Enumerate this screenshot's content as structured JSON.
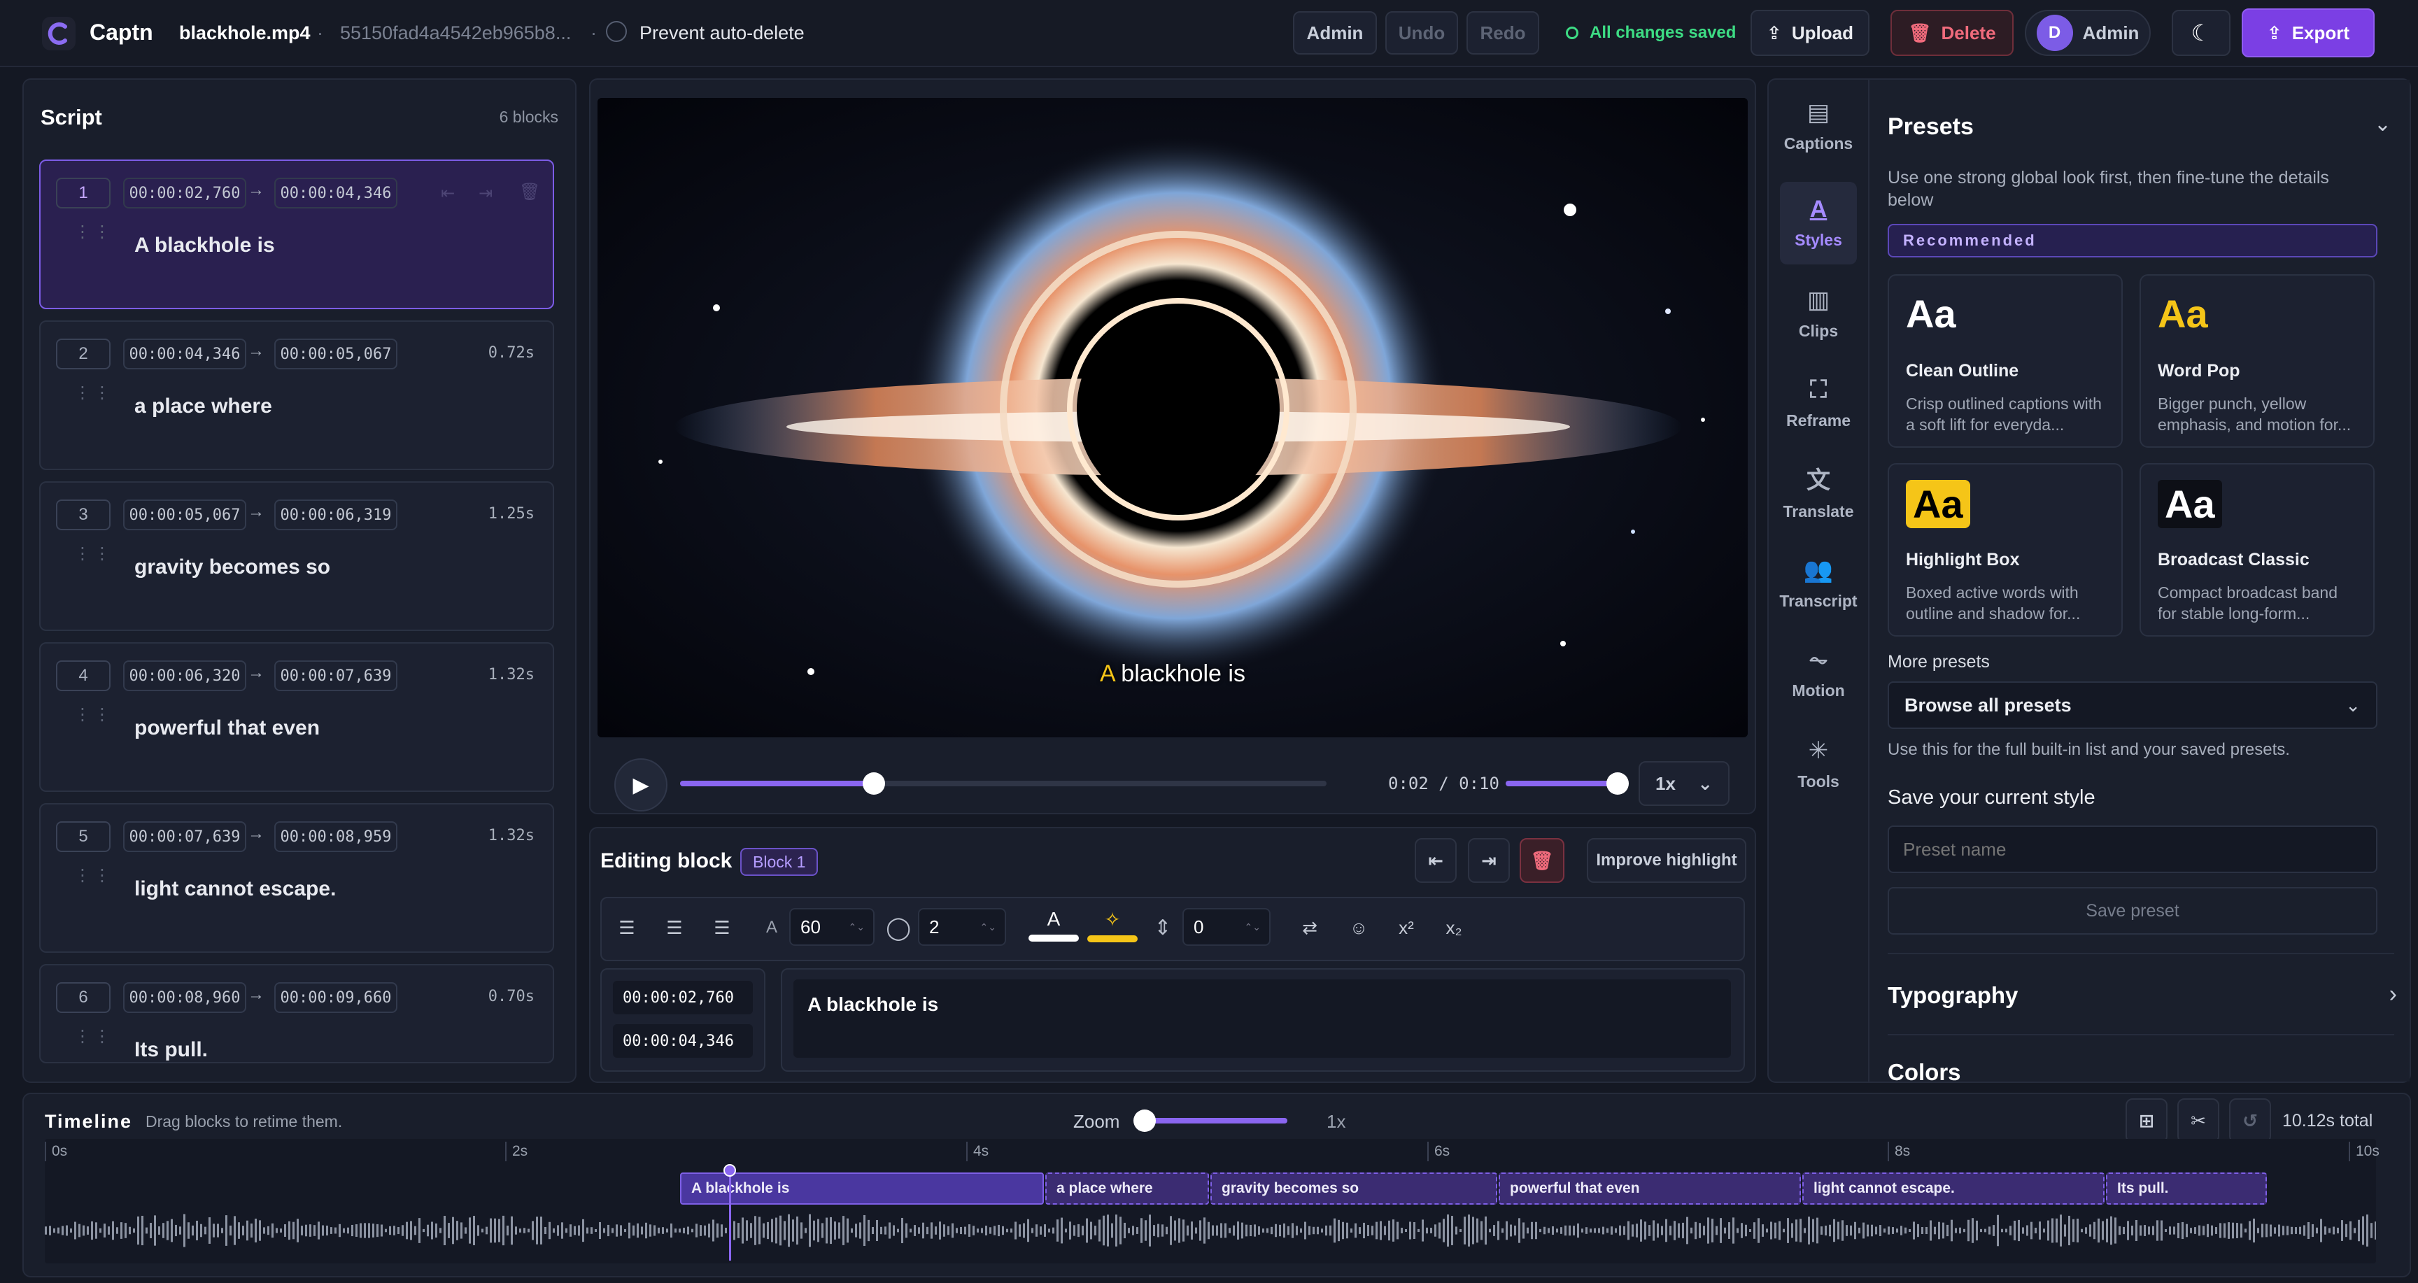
{
  "app": {
    "name": "Captn",
    "file_name": "blackhole.mp4",
    "file_id": "55150fad4a4542eb965b8...",
    "prevent_label": "Prevent auto-delete"
  },
  "header": {
    "admin_label": "Admin",
    "undo_label": "Undo",
    "redo_label": "Redo",
    "status": "All changes saved",
    "upload_label": "Upload",
    "delete_label": "Delete",
    "user_initial": "D",
    "user_name": "Admin",
    "export_label": "Export"
  },
  "script": {
    "title": "Script",
    "count": "6 blocks",
    "blocks": [
      {
        "num": "1",
        "start": "00:00:02,760",
        "end": "00:00:04,346",
        "duration": "",
        "text": "A blackhole is"
      },
      {
        "num": "2",
        "start": "00:00:04,346",
        "end": "00:00:05,067",
        "duration": "0.72s",
        "text": "a place where"
      },
      {
        "num": "3",
        "start": "00:00:05,067",
        "end": "00:00:06,319",
        "duration": "1.25s",
        "text": "gravity becomes so"
      },
      {
        "num": "4",
        "start": "00:00:06,320",
        "end": "00:00:07,639",
        "duration": "1.32s",
        "text": "powerful that even"
      },
      {
        "num": "5",
        "start": "00:00:07,639",
        "end": "00:00:08,959",
        "duration": "1.32s",
        "text": "light cannot escape."
      },
      {
        "num": "6",
        "start": "00:00:08,960",
        "end": "00:00:09,660",
        "duration": "0.70s",
        "text": "Its pull."
      }
    ]
  },
  "player": {
    "caption_highlight": "A",
    "caption_rest": "blackhole is",
    "time": "0:02 / 0:10",
    "speed": "1x",
    "progress": 0.3,
    "volume": 1.0
  },
  "editing": {
    "title": "Editing block",
    "badge": "Block 1",
    "improve_label": "Improve highlight",
    "font_size": "60",
    "outline": "2",
    "offset": "0",
    "start": "00:00:02,760",
    "end": "00:00:04,346",
    "text": "A blackhole is",
    "text_color": "#ffffff",
    "highlight_color": "#f5c518"
  },
  "sidebar": {
    "items": [
      {
        "label": "Captions",
        "icon": "captions-icon"
      },
      {
        "label": "Styles",
        "icon": "styles-icon"
      },
      {
        "label": "Clips",
        "icon": "clips-icon"
      },
      {
        "label": "Reframe",
        "icon": "reframe-icon"
      },
      {
        "label": "Translate",
        "icon": "translate-icon"
      },
      {
        "label": "Transcript",
        "icon": "transcript-icon"
      },
      {
        "label": "Motion",
        "icon": "motion-icon"
      },
      {
        "label": "Tools",
        "icon": "tools-icon"
      }
    ]
  },
  "presets": {
    "title": "Presets",
    "description": "Use one strong global look first, then fine-tune the details below",
    "recommended": "Recommended",
    "cards": [
      {
        "aa": "Aa",
        "name": "Clean Outline",
        "desc": "Crisp outlined captions with a soft lift for everyda..."
      },
      {
        "aa": "Aa",
        "name": "Word Pop",
        "desc": "Bigger punch, yellow emphasis, and motion for..."
      },
      {
        "aa": "Aa",
        "name": "Highlight Box",
        "desc": "Boxed active words with outline and shadow for..."
      },
      {
        "aa": "Aa",
        "name": "Broadcast Classic",
        "desc": "Compact broadcast band for stable long-form..."
      }
    ],
    "more_label": "More presets",
    "browse_label": "Browse all presets",
    "browse_hint": "Use this for the full built-in list and your saved presets.",
    "save_title": "Save your current style",
    "name_placeholder": "Preset name",
    "save_button": "Save preset",
    "typography": "Typography",
    "next_section": "Colors"
  },
  "timeline": {
    "title": "Timeline",
    "hint": "Drag blocks to retime them.",
    "zoom_label": "Zoom",
    "zoom_value": "1x",
    "total": "10.12s total",
    "ticks": [
      "0s",
      "2s",
      "4s",
      "6s",
      "8s",
      "10s"
    ],
    "blocks": [
      "A blackhole is",
      "a place where",
      "gravity becomes so",
      "powerful that even",
      "light cannot escape.",
      "Its pull."
    ]
  },
  "colors": {
    "accent": "#7c5ce6",
    "export": "#7b3fe4",
    "delete": "#e05a6a",
    "saved": "#3ddc84"
  }
}
